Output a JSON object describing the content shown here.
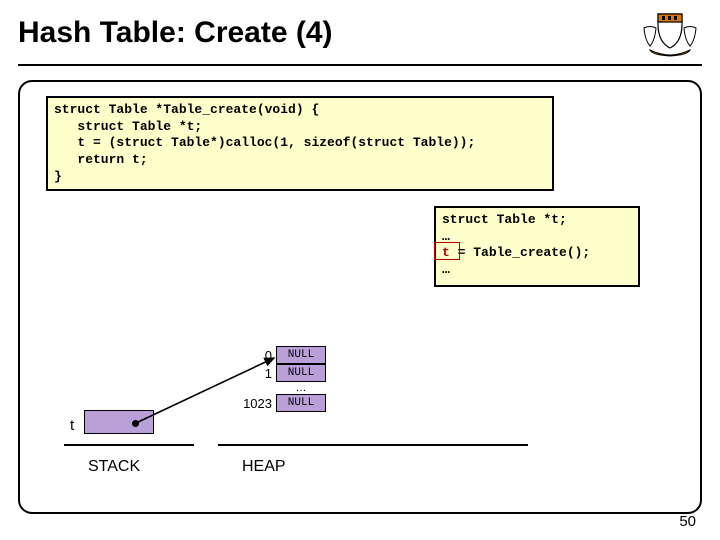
{
  "title": "Hash Table: Create (4)",
  "code_main": "struct Table *Table_create(void) {\n   struct Table *t;\n   t = (struct Table*)calloc(1, sizeof(struct Table));\n   return t;\n}",
  "code_caller_l1": "struct Table *t;",
  "code_caller_l2": "…",
  "code_caller_l3a": "t",
  "code_caller_l3b": " = Table_create();",
  "code_caller_l4": "…",
  "stack": {
    "var": "t",
    "label": "STACK"
  },
  "heap": {
    "rows": [
      {
        "idx": "0",
        "val": "NULL"
      },
      {
        "idx": "1",
        "val": "NULL"
      }
    ],
    "ellipsis": "…",
    "last": {
      "idx": "1023",
      "val": "NULL"
    },
    "label": "HEAP"
  },
  "page": "50"
}
